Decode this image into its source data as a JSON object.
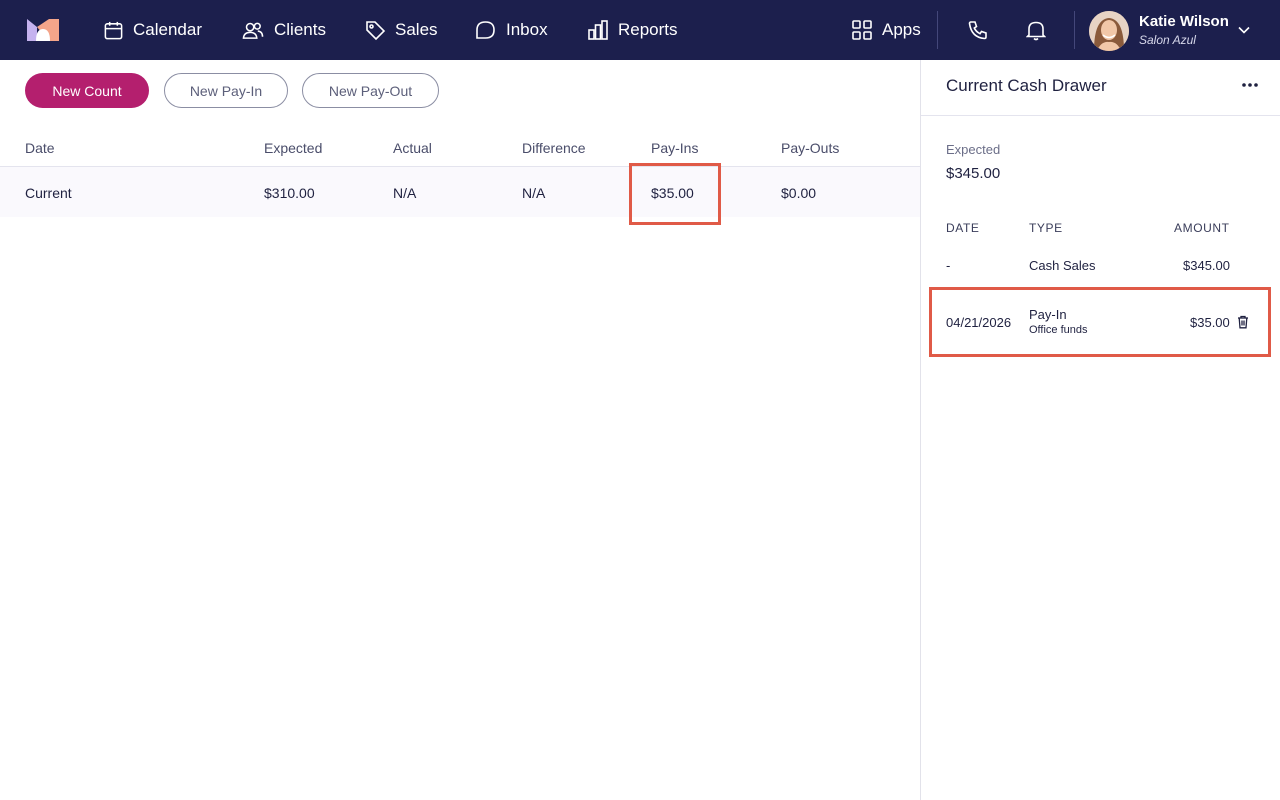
{
  "app": {
    "brand_icon": "brand-logo-icon"
  },
  "nav": {
    "items": [
      {
        "label": "Calendar",
        "icon": "calendar-icon"
      },
      {
        "label": "Clients",
        "icon": "users-icon"
      },
      {
        "label": "Sales",
        "icon": "tag-icon"
      },
      {
        "label": "Inbox",
        "icon": "chat-bubble-icon"
      },
      {
        "label": "Reports",
        "icon": "bar-chart-icon"
      }
    ],
    "apps": {
      "label": "Apps",
      "icon": "grid-icon"
    },
    "phone_icon": "phone-icon",
    "bell_icon": "bell-icon"
  },
  "user": {
    "name": "Katie Wilson",
    "business": "Salon Azul"
  },
  "actions": {
    "new_count": "New Count",
    "new_pay_in": "New Pay-In",
    "new_pay_out": "New Pay-Out"
  },
  "table": {
    "columns": [
      "Date",
      "Expected",
      "Actual",
      "Difference",
      "Pay-Ins",
      "Pay-Outs"
    ],
    "rows": [
      {
        "date": "Current",
        "expected": "$310.00",
        "actual": "N/A",
        "difference": "N/A",
        "pay_ins": "$35.00",
        "pay_outs": "$0.00"
      }
    ]
  },
  "drawer": {
    "title": "Current Cash Drawer",
    "expected_label": "Expected",
    "expected_value": "$345.00",
    "columns": [
      "DATE",
      "TYPE",
      "AMOUNT"
    ],
    "entries": [
      {
        "date": "-",
        "type": "Cash Sales",
        "note": "",
        "amount": "$345.00"
      },
      {
        "date": "04/21/2026",
        "type": "Pay-In",
        "note": "Office funds",
        "amount": "$35.00"
      }
    ]
  },
  "colors": {
    "topbar": "#1c1f4d",
    "primary": "#b41f6e",
    "highlight": "#e05a47"
  }
}
